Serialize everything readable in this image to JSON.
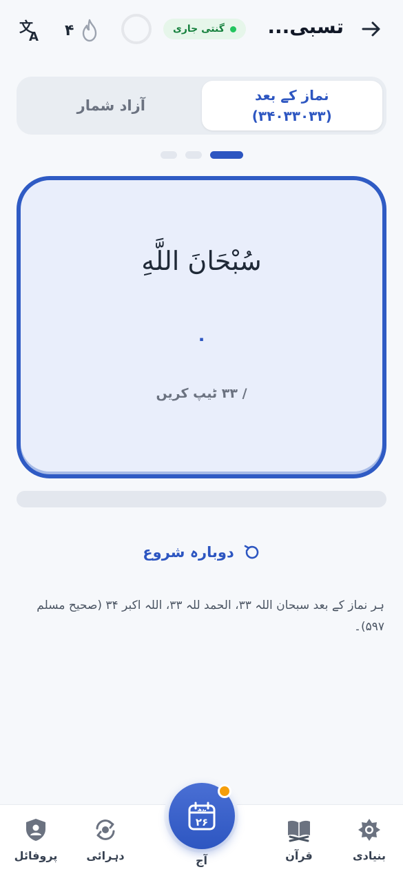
{
  "header": {
    "title": "تسبی...",
    "streak_count": "۴",
    "status_badge": "گنتی جاری"
  },
  "tabs": [
    {
      "label": "نماز کے بعد",
      "sub": "(۳۴۰۳۳۰۳۳)",
      "active": true
    },
    {
      "label": "آزاد شمار",
      "active": false
    }
  ],
  "pager": {
    "total": 3,
    "active_index": 2
  },
  "counter": {
    "dhikr": "سُبْحَانَ اللَّهِ",
    "count": "۰",
    "target_text": "/ ۳۳ ٹیپ کریں",
    "progress": 0
  },
  "reset_label": "دوبارہ شروع",
  "note": "ہر نماز کے بعد سبحان اللہ ۳۳، الحمد للہ ۳۳، اللہ اکبر ۳۴ (صحیح مسلم ۵۹۷)۔",
  "nav": {
    "basic": "بنیادی",
    "quran": "قرآن",
    "today": "آج",
    "today_day": "۲۶",
    "today_weekday": "بدھ",
    "review": "دہرائی",
    "profile": "پروفائل"
  },
  "colors": {
    "accent": "#2d56c1",
    "badge_bg": "#e6f6ea",
    "badge_text": "#15803d",
    "notification": "#f59e0b"
  }
}
